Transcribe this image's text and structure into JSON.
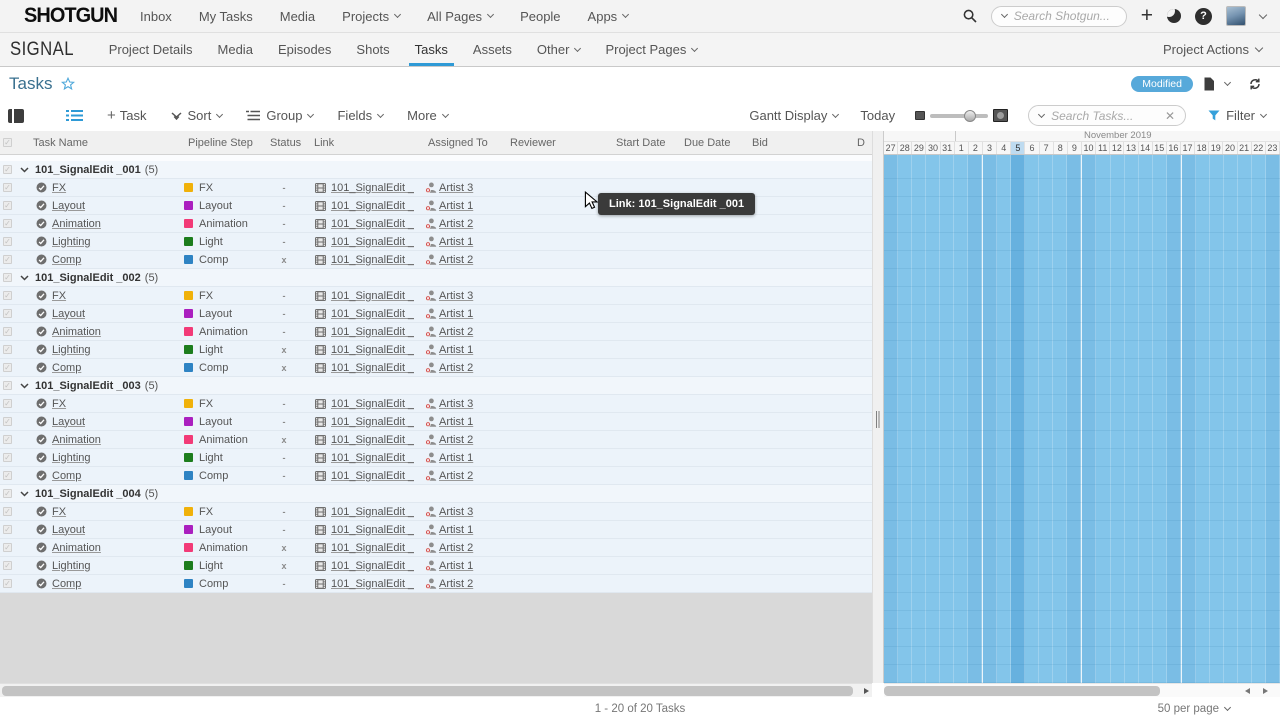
{
  "top_nav": {
    "logo": "SHOTGUN",
    "items": [
      {
        "label": "Inbox"
      },
      {
        "label": "My Tasks"
      },
      {
        "label": "Media"
      },
      {
        "label": "Projects",
        "chevron": true
      },
      {
        "label": "All Pages",
        "chevron": true
      },
      {
        "label": "People"
      },
      {
        "label": "Apps",
        "chevron": true
      }
    ],
    "search_placeholder": "Search Shotgun..."
  },
  "project_nav": {
    "project_name": "SIGNAL",
    "items": [
      {
        "label": "Project Details"
      },
      {
        "label": "Media"
      },
      {
        "label": "Episodes"
      },
      {
        "label": "Shots"
      },
      {
        "label": "Tasks",
        "active": true
      },
      {
        "label": "Assets"
      },
      {
        "label": "Other",
        "chevron": true
      },
      {
        "label": "Project Pages",
        "chevron": true
      }
    ],
    "project_actions_label": "Project Actions"
  },
  "page_header": {
    "title": "Tasks",
    "modified_badge": "Modified"
  },
  "toolbar": {
    "add_task_label": "Task",
    "sort_label": "Sort",
    "group_label": "Group",
    "fields_label": "Fields",
    "more_label": "More",
    "gantt_display_label": "Gantt Display",
    "today_label": "Today",
    "search_placeholder": "Search Tasks...",
    "filter_label": "Filter"
  },
  "table": {
    "columns": [
      "Task Name",
      "Pipeline Step",
      "Status",
      "Link",
      "Assigned To",
      "Reviewer",
      "Start Date",
      "Due Date",
      "Bid",
      "D"
    ],
    "step_colors": {
      "FX": "#f0b10a",
      "Layout": "#aa1fbf",
      "Animation": "#f23a77",
      "Light": "#1d7d1d",
      "Comp": "#2e83c3"
    },
    "groups": [
      {
        "name": "101_SignalEdit _001",
        "count": "(5)",
        "tasks": [
          {
            "name": "FX",
            "step": "FX",
            "status": "-",
            "link": "101_SignalEdit _",
            "assignee": "Artist 3"
          },
          {
            "name": "Layout",
            "step": "Layout",
            "status": "-",
            "link": "101_SignalEdit _",
            "assignee": "Artist 1"
          },
          {
            "name": "Animation",
            "step": "Animation",
            "status": "-",
            "link": "101_SignalEdit _",
            "assignee": "Artist 2"
          },
          {
            "name": "Lighting",
            "step": "Light",
            "status": "-",
            "link": "101_SignalEdit _",
            "assignee": "Artist 1"
          },
          {
            "name": "Comp",
            "step": "Comp",
            "status": "x",
            "link": "101_SignalEdit _",
            "assignee": "Artist 2"
          }
        ]
      },
      {
        "name": "101_SignalEdit _002",
        "count": "(5)",
        "tasks": [
          {
            "name": "FX",
            "step": "FX",
            "status": "-",
            "link": "101_SignalEdit _",
            "assignee": "Artist 3"
          },
          {
            "name": "Layout",
            "step": "Layout",
            "status": "-",
            "link": "101_SignalEdit _",
            "assignee": "Artist 1"
          },
          {
            "name": "Animation",
            "step": "Animation",
            "status": "-",
            "link": "101_SignalEdit _",
            "assignee": "Artist 2"
          },
          {
            "name": "Lighting",
            "step": "Light",
            "status": "x",
            "link": "101_SignalEdit _",
            "assignee": "Artist 1"
          },
          {
            "name": "Comp",
            "step": "Comp",
            "status": "x",
            "link": "101_SignalEdit _",
            "assignee": "Artist 2"
          }
        ]
      },
      {
        "name": "101_SignalEdit _003",
        "count": "(5)",
        "tasks": [
          {
            "name": "FX",
            "step": "FX",
            "status": "-",
            "link": "101_SignalEdit _",
            "assignee": "Artist 3"
          },
          {
            "name": "Layout",
            "step": "Layout",
            "status": "-",
            "link": "101_SignalEdit _",
            "assignee": "Artist 1"
          },
          {
            "name": "Animation",
            "step": "Animation",
            "status": "x",
            "link": "101_SignalEdit _",
            "assignee": "Artist 2"
          },
          {
            "name": "Lighting",
            "step": "Light",
            "status": "-",
            "link": "101_SignalEdit _",
            "assignee": "Artist 1"
          },
          {
            "name": "Comp",
            "step": "Comp",
            "status": "-",
            "link": "101_SignalEdit _",
            "assignee": "Artist 2"
          }
        ]
      },
      {
        "name": "101_SignalEdit _004",
        "count": "(5)",
        "tasks": [
          {
            "name": "FX",
            "step": "FX",
            "status": "-",
            "link": "101_SignalEdit _",
            "assignee": "Artist 3"
          },
          {
            "name": "Layout",
            "step": "Layout",
            "status": "-",
            "link": "101_SignalEdit _",
            "assignee": "Artist 1"
          },
          {
            "name": "Animation",
            "step": "Animation",
            "status": "x",
            "link": "101_SignalEdit _",
            "assignee": "Artist 2"
          },
          {
            "name": "Lighting",
            "step": "Light",
            "status": "x",
            "link": "101_SignalEdit _",
            "assignee": "Artist 1"
          },
          {
            "name": "Comp",
            "step": "Comp",
            "status": "-",
            "link": "101_SignalEdit _",
            "assignee": "Artist 2"
          }
        ]
      }
    ]
  },
  "gantt": {
    "month_label": "November 2019",
    "days": [
      {
        "label": "27",
        "weekend": true
      },
      {
        "label": "28"
      },
      {
        "label": "29"
      },
      {
        "label": "30"
      },
      {
        "label": "31"
      },
      {
        "label": "1"
      },
      {
        "label": "2",
        "weekend": true
      },
      {
        "label": "3",
        "weekend": true,
        "week_start": true
      },
      {
        "label": "4"
      },
      {
        "label": "5",
        "today": true
      },
      {
        "label": "6"
      },
      {
        "label": "7"
      },
      {
        "label": "8"
      },
      {
        "label": "9",
        "weekend": true
      },
      {
        "label": "10",
        "weekend": true,
        "week_start": true
      },
      {
        "label": "11"
      },
      {
        "label": "12"
      },
      {
        "label": "13"
      },
      {
        "label": "14"
      },
      {
        "label": "15"
      },
      {
        "label": "16",
        "weekend": true
      },
      {
        "label": "17",
        "weekend": true,
        "week_start": true
      },
      {
        "label": "18"
      },
      {
        "label": "19"
      },
      {
        "label": "20"
      },
      {
        "label": "21"
      },
      {
        "label": "22"
      },
      {
        "label": "23",
        "weekend": true
      }
    ]
  },
  "tooltip": {
    "text": "Link: 101_SignalEdit _001"
  },
  "footer": {
    "pagination": "1 - 20 of 20 Tasks",
    "per_page": "50 per page"
  }
}
